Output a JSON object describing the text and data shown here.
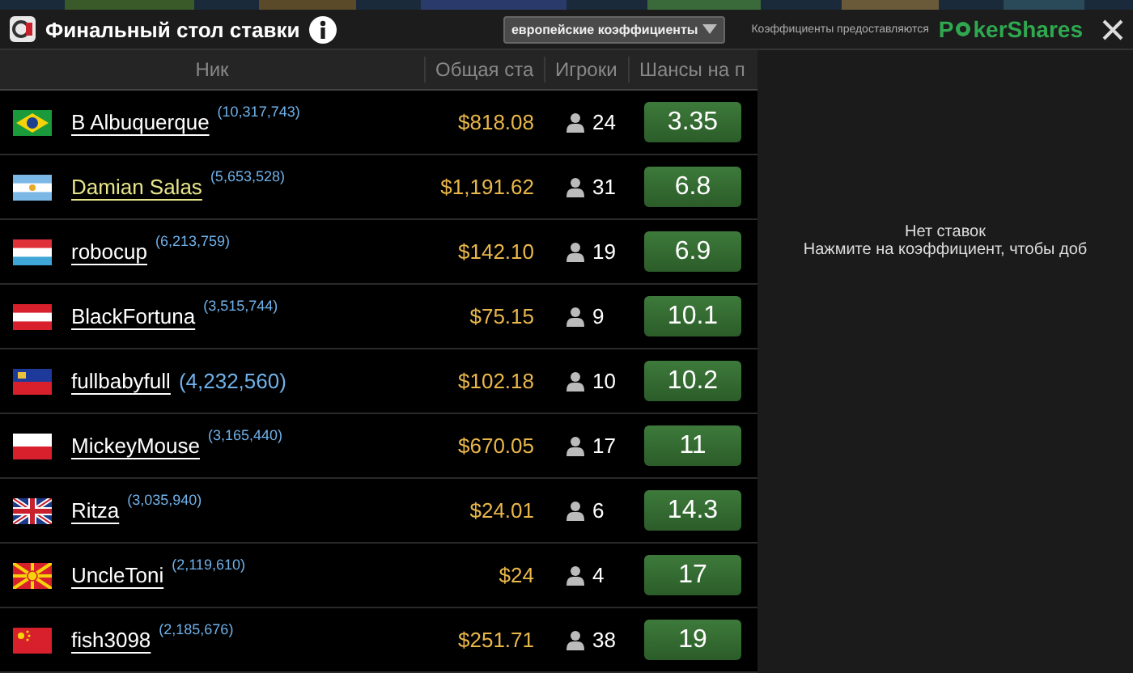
{
  "window": {
    "title": "Финальный стол ставки"
  },
  "odds_format": {
    "value": "европейские коэффициенты"
  },
  "provider": {
    "caption": "Коэффициенты предоставляются",
    "brand_first": "P",
    "brand_rest": "ker",
    "brand_second": "Shares"
  },
  "table": {
    "columns": [
      "Ник",
      "Общая ста",
      "Игроки",
      "Шансы на п"
    ],
    "rows": [
      {
        "kind": "br",
        "name": "B Albuquerque",
        "rank": "(10,317,743)",
        "highlighted": false,
        "rank_emphasized": false,
        "stake": "$818.08",
        "players": "24",
        "odds": "3.35"
      },
      {
        "kind": "ar",
        "name": "Damian Salas",
        "rank": "(5,653,528)",
        "highlighted": true,
        "rank_emphasized": false,
        "stake": "$1,191.62",
        "players": "31",
        "odds": "6.8"
      },
      {
        "kind": "lu",
        "name": "robocup",
        "rank": "(6,213,759)",
        "highlighted": false,
        "rank_emphasized": false,
        "stake": "$142.10",
        "players": "19",
        "odds": "6.9"
      },
      {
        "kind": "at",
        "name": "BlackFortuna",
        "rank": "(3,515,744)",
        "highlighted": false,
        "rank_emphasized": false,
        "stake": "$75.15",
        "players": "9",
        "odds": "10.1"
      },
      {
        "kind": "li",
        "name": "fullbabyfull",
        "rank": "(4,232,560)",
        "highlighted": false,
        "rank_emphasized": true,
        "stake": "$102.18",
        "players": "10",
        "odds": "10.2"
      },
      {
        "kind": "pl",
        "name": "MickeyMouse",
        "rank": "(3,165,440)",
        "highlighted": false,
        "rank_emphasized": false,
        "stake": "$670.05",
        "players": "17",
        "odds": "11"
      },
      {
        "kind": "gb",
        "name": "Ritza",
        "rank": "(3,035,940)",
        "highlighted": false,
        "rank_emphasized": false,
        "stake": "$24.01",
        "players": "6",
        "odds": "14.3"
      },
      {
        "kind": "mk",
        "name": "UncleToni",
        "rank": "(2,119,610)",
        "highlighted": false,
        "rank_emphasized": false,
        "stake": "$24",
        "players": "4",
        "odds": "17"
      },
      {
        "kind": "cn",
        "name": "fish3098",
        "rank": "(2,185,676)",
        "highlighted": false,
        "rank_emphasized": false,
        "stake": "$251.71",
        "players": "38",
        "odds": "19"
      }
    ]
  },
  "bet_slip": {
    "empty_title": "Нет ставок",
    "hint": "Нажмите на коэффициент, чтобы доб"
  }
}
